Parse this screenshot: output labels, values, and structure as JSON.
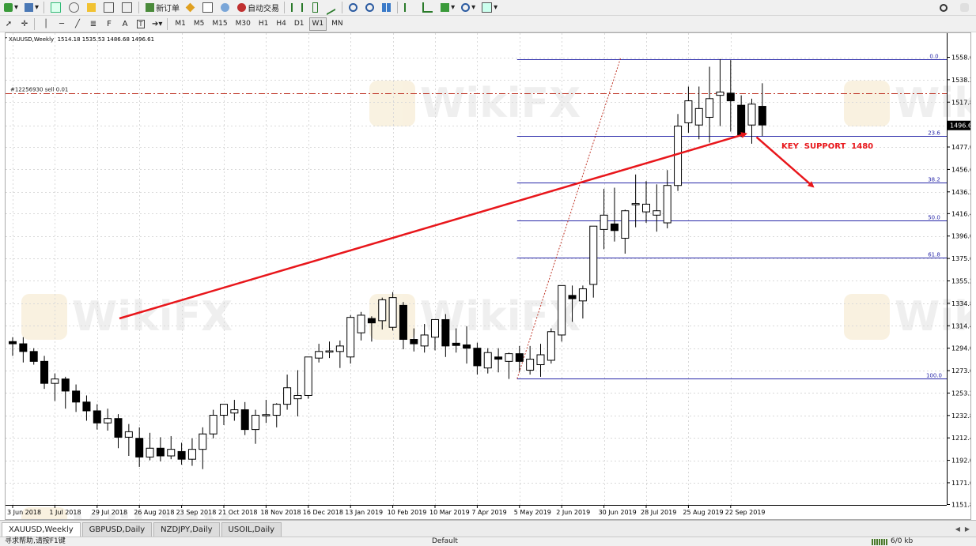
{
  "toolbar_top": {
    "new_order_label": "新订单",
    "auto_trading_label": "自动交易"
  },
  "toolbar_bottom": {
    "timeframes": [
      "M1",
      "M5",
      "M15",
      "M30",
      "H1",
      "H4",
      "D1",
      "W1",
      "MN"
    ],
    "active_timeframe": "W1",
    "text_tool_label": "A"
  },
  "chart": {
    "header": "XAUUSD,Weekly  1514.18 1535.53 1486.68 1496.61",
    "order_line_label": "#12256930 sell 0.01",
    "annotation": "KEY  SUPPORT  1480",
    "current_price_label": "1496.61",
    "watermark": "WikiFX",
    "colors": {
      "arrow": "#e8161b",
      "fib_line": "#2727a8",
      "order_line": "#c0392b",
      "grid": "#d9d9d9",
      "candle_bull": "#ffffff",
      "candle_bear": "#000000"
    }
  },
  "chart_data": {
    "type": "candlestick",
    "symbol": "XAUUSD",
    "timeframe": "Weekly",
    "ylim": [
      1151.8,
      1567
    ],
    "y_ticks": [
      1558.6,
      1538.2,
      1517.8,
      1496.61,
      1477.0,
      1456.6,
      1436.2,
      1416.4,
      1396.0,
      1375.6,
      1355.2,
      1334.8,
      1314.4,
      1294.0,
      1273.6,
      1253.2,
      1232.8,
      1212.4,
      1192.0,
      1171.6,
      1151.8
    ],
    "x_labels": [
      "3 Jun 2018",
      "1 Jul 2018",
      "29 Jul 2018",
      "26 Aug 2018",
      "23 Sep 2018",
      "21 Oct 2018",
      "18 Nov 2018",
      "16 Dec 2018",
      "13 Jan 2019",
      "10 Feb 2019",
      "10 Mar 2019",
      "7 Apr 2019",
      "5 May 2019",
      "2 Jun 2019",
      "30 Jun 2019",
      "28 Jul 2019",
      "25 Aug 2019",
      "22 Sep 2019"
    ],
    "x_label_bar_index": [
      0,
      4,
      8,
      12,
      16,
      20,
      24,
      28,
      32,
      36,
      40,
      44,
      48,
      52,
      56,
      60,
      64,
      68
    ],
    "fibonacci": [
      {
        "level": "0.0",
        "price": 1556.5
      },
      {
        "level": "23.6",
        "price": 1487.0
      },
      {
        "level": "38.2",
        "price": 1444.9
      },
      {
        "level": "50.0",
        "price": 1410.4
      },
      {
        "level": "61.8",
        "price": 1376.3
      },
      {
        "level": "100.0",
        "price": 1266.2
      }
    ],
    "order_line_price": 1526.0,
    "candles": [
      [
        1300,
        1304,
        1287,
        1298
      ],
      [
        1298,
        1304,
        1281,
        1291
      ],
      [
        1291,
        1294,
        1279,
        1282
      ],
      [
        1282,
        1287,
        1257,
        1262
      ],
      [
        1262,
        1271,
        1246,
        1266
      ],
      [
        1266,
        1268,
        1239,
        1255
      ],
      [
        1255,
        1261,
        1236,
        1245
      ],
      [
        1245,
        1251,
        1228,
        1237
      ],
      [
        1237,
        1243,
        1220,
        1226
      ],
      [
        1226,
        1239,
        1219,
        1230
      ],
      [
        1230,
        1234,
        1203,
        1213
      ],
      [
        1213,
        1225,
        1196,
        1218
      ],
      [
        1212,
        1222,
        1186,
        1195
      ],
      [
        1195,
        1217,
        1192,
        1203
      ],
      [
        1203,
        1213,
        1191,
        1196
      ],
      [
        1196,
        1214,
        1193,
        1202
      ],
      [
        1200,
        1208,
        1188,
        1193
      ],
      [
        1193,
        1212,
        1187,
        1202
      ],
      [
        1202,
        1222,
        1184,
        1216
      ],
      [
        1216,
        1238,
        1212,
        1233
      ],
      [
        1233,
        1243,
        1224,
        1243
      ],
      [
        1235,
        1247,
        1228,
        1238
      ],
      [
        1238,
        1245,
        1215,
        1220
      ],
      [
        1220,
        1238,
        1207,
        1233
      ],
      [
        1233,
        1247,
        1226,
        1233
      ],
      [
        1233,
        1244,
        1222,
        1243
      ],
      [
        1243,
        1270,
        1238,
        1258
      ],
      [
        1248,
        1274,
        1232,
        1251
      ],
      [
        1251,
        1284,
        1248,
        1286
      ],
      [
        1285,
        1298,
        1281,
        1291
      ],
      [
        1291,
        1300,
        1285,
        1291
      ],
      [
        1291,
        1301,
        1276,
        1296
      ],
      [
        1286,
        1324,
        1280,
        1322
      ],
      [
        1308,
        1327,
        1301,
        1324
      ],
      [
        1321,
        1323,
        1300,
        1317
      ],
      [
        1319,
        1340,
        1311,
        1338
      ],
      [
        1313,
        1345,
        1310,
        1340
      ],
      [
        1333,
        1336,
        1293,
        1302
      ],
      [
        1302,
        1312,
        1291,
        1298
      ],
      [
        1296,
        1316,
        1290,
        1306
      ],
      [
        1304,
        1320,
        1292,
        1320
      ],
      [
        1320,
        1325,
        1286,
        1296
      ],
      [
        1298,
        1312,
        1290,
        1297
      ],
      [
        1297,
        1314,
        1280,
        1294
      ],
      [
        1294,
        1299,
        1270,
        1278
      ],
      [
        1276,
        1294,
        1271,
        1290
      ],
      [
        1286,
        1294,
        1272,
        1284
      ],
      [
        1282,
        1290,
        1266,
        1289
      ],
      [
        1289,
        1296,
        1273,
        1282
      ],
      [
        1274,
        1296,
        1270,
        1284
      ],
      [
        1279,
        1298,
        1268,
        1288
      ],
      [
        1283,
        1312,
        1280,
        1309
      ],
      [
        1306,
        1350,
        1300,
        1351
      ],
      [
        1342,
        1351,
        1318,
        1339
      ],
      [
        1337,
        1351,
        1321,
        1348
      ],
      [
        1352,
        1397,
        1340,
        1405
      ],
      [
        1402,
        1439,
        1384,
        1415
      ],
      [
        1407,
        1440,
        1391,
        1401
      ],
      [
        1394,
        1420,
        1380,
        1419
      ],
      [
        1425,
        1452,
        1404,
        1425
      ],
      [
        1418,
        1446,
        1408,
        1425
      ],
      [
        1415,
        1443,
        1400,
        1419
      ],
      [
        1408,
        1456,
        1403,
        1442
      ],
      [
        1442,
        1507,
        1437,
        1496
      ],
      [
        1499,
        1532,
        1490,
        1519
      ],
      [
        1497,
        1532,
        1484,
        1512
      ],
      [
        1504,
        1550,
        1481,
        1521
      ],
      [
        1524,
        1557,
        1496,
        1527
      ],
      [
        1526,
        1556,
        1491,
        1519
      ],
      [
        1515,
        1524,
        1486,
        1488
      ],
      [
        1497,
        1521,
        1480,
        1516
      ],
      [
        1514,
        1535,
        1487,
        1497
      ]
    ]
  },
  "tabs": {
    "items": [
      "XAUUSD,Weekly",
      "GBPUSD,Daily",
      "NZDJPY,Daily",
      "USOIL,Daily"
    ],
    "active_index": 0
  },
  "status_bar": {
    "help_text": "寻求帮助,请按F1键",
    "profile": "Default",
    "traffic": "6/0 kb"
  }
}
